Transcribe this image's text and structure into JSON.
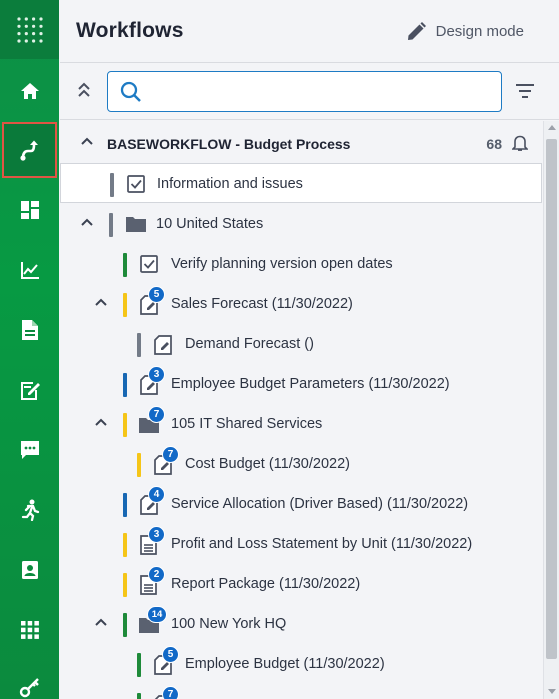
{
  "header": {
    "title": "Workflows",
    "design_mode_label": "Design mode"
  },
  "search": {
    "value": "",
    "placeholder": ""
  },
  "rail": {
    "items": [
      {
        "name": "apps-grid-icon"
      },
      {
        "name": "home-icon"
      },
      {
        "name": "workflow-icon",
        "active": true
      },
      {
        "name": "dashboard-icon"
      },
      {
        "name": "analysis-chart-icon"
      },
      {
        "name": "document-icon"
      },
      {
        "name": "edit-form-icon"
      },
      {
        "name": "chat-icon"
      },
      {
        "name": "run-icon"
      },
      {
        "name": "contact-card-icon"
      },
      {
        "name": "grid-icon"
      },
      {
        "name": "key-icon"
      }
    ]
  },
  "colors": {
    "green": "#1e8a3a",
    "yellow": "#f5c518",
    "blue": "#1767b3",
    "gray": "#737b88",
    "badge": "#1269c7",
    "accent": "#1e7bc4"
  },
  "tree": {
    "root": {
      "label": "BASEWORKFLOW - Budget Process",
      "count": "68"
    },
    "rows": [
      {
        "label": "Information and issues",
        "icon": "checkbox-icon",
        "bar": "gray",
        "selected": true
      },
      {
        "label": "10 United States",
        "icon": "folder-icon",
        "bar": "gray",
        "expanded": true
      },
      {
        "label": "Verify planning version open dates",
        "icon": "checkbox-icon",
        "bar": "green"
      },
      {
        "label": "Sales Forecast (11/30/2022)",
        "icon": "edit-doc-icon",
        "bar": "yellow",
        "badge": "5",
        "expanded": true
      },
      {
        "label": "Demand Forecast ()",
        "icon": "edit-doc-icon",
        "bar": "gray"
      },
      {
        "label": "Employee Budget Parameters (11/30/2022)",
        "icon": "edit-doc-icon",
        "bar": "blue",
        "badge": "3"
      },
      {
        "label": "105 IT Shared Services",
        "icon": "folder-icon",
        "bar": "yellow",
        "badge": "7",
        "expanded": true
      },
      {
        "label": "Cost Budget (11/30/2022)",
        "icon": "edit-doc-icon",
        "bar": "yellow",
        "badge": "7"
      },
      {
        "label": "Service Allocation (Driver Based) (11/30/2022)",
        "icon": "edit-doc-icon",
        "bar": "blue",
        "badge": "4"
      },
      {
        "label": "Profit and Loss Statement by Unit (11/30/2022)",
        "icon": "report-icon",
        "bar": "yellow",
        "badge": "3"
      },
      {
        "label": "Report Package (11/30/2022)",
        "icon": "report-icon",
        "bar": "yellow",
        "badge": "2"
      },
      {
        "label": "100 New York HQ",
        "icon": "folder-icon",
        "bar": "green",
        "badge": "14",
        "expanded": true
      },
      {
        "label": "Employee Budget (11/30/2022)",
        "icon": "edit-doc-icon",
        "bar": "green",
        "badge": "5"
      },
      {
        "label": "",
        "icon": "edit-doc-icon",
        "bar": "green",
        "badge": "7"
      }
    ]
  }
}
